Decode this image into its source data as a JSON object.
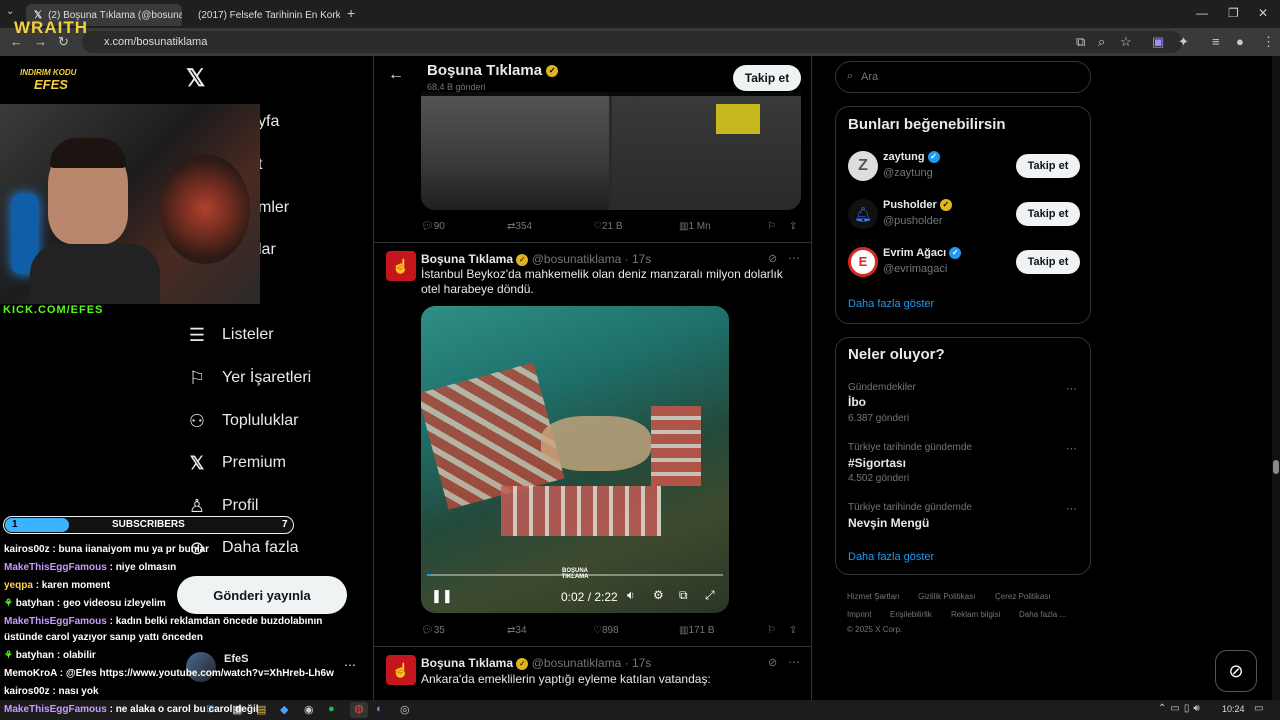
{
  "browser": {
    "tabs": [
      {
        "title": "(2) Boşuna Tıklama (@bosunati...",
        "favicon": "x-icon"
      },
      {
        "title": "(2017) Felsefe Tarihinin En Korku...",
        "favicon": "youtube-icon"
      }
    ],
    "url": "x.com/bosunatiklama"
  },
  "overlay": {
    "brand": "WRAITH",
    "discount_label": "INDIRIM KODU",
    "discount_code": "EFES",
    "kick_url": "KICK.COM/EFES",
    "subscribers_label": "SUBSCRIBERS",
    "subscribers_current": "1",
    "subscribers_goal": "7",
    "subscribers_progress": 0.14
  },
  "nav": {
    "partial_items": [
      "yfa",
      "t",
      "mler",
      "lar"
    ],
    "items": [
      {
        "label": "Listeler",
        "icon": "list-icon"
      },
      {
        "label": "Yer İşaretleri",
        "icon": "bookmark-icon"
      },
      {
        "label": "Topluluklar",
        "icon": "communities-icon"
      },
      {
        "label": "Premium",
        "icon": "x-icon"
      },
      {
        "label": "Profil",
        "icon": "profile-icon"
      },
      {
        "label": "Daha fazla",
        "icon": "more-icon"
      }
    ],
    "post_button": "Gönderi yayınla",
    "account_name": "EfeS",
    "account_handle": "@..."
  },
  "chat": [
    {
      "user": "kairos00z",
      "msg": ": buna iianaiyom mu ya pr bunlar",
      "color": "u1"
    },
    {
      "user": "MakeThisEggFamous",
      "msg": ": niye olmasın",
      "color": "u2"
    },
    {
      "user": "yeqpa",
      "msg": ": karen moment",
      "color": "u3"
    },
    {
      "user": "batyhan",
      "msg": ": geo videosu izleyelim",
      "color": "u1"
    },
    {
      "user": "MakeThisEggFamous",
      "msg": ": kadın belki reklamdan öncede buzdolabının",
      "color": "u2"
    },
    {
      "user": "",
      "msg": "üstünde carol yazıyor sanıp yattı önceden",
      "color": "u1"
    },
    {
      "user": "batyhan",
      "msg": ": olabilir",
      "color": "u1"
    },
    {
      "user": "MemoKroA",
      "msg": ": @Efes https://www.youtube.com/watch?v=XhHreb-Lh6w",
      "color": "u1"
    },
    {
      "user": "kairos00z",
      "msg": ": nası yok",
      "color": "u1"
    },
    {
      "user": "MakeThisEggFamous",
      "msg": ": ne alaka o carol bu carol değil",
      "color": "u2"
    }
  ],
  "profile_header": {
    "name": "Boşuna Tıklama",
    "posts": "68,4 B gönderi",
    "follow": "Takip et"
  },
  "tweets": [
    {
      "stats": {
        "replies": "90",
        "reposts": "354",
        "likes": "21 B",
        "views": "1 Mn"
      }
    },
    {
      "name": "Boşuna Tıklama",
      "handle": "@bosunatiklama",
      "time": "· 17s",
      "text": "İstanbul Beykoz'da mahkemelik olan deniz manzaralı milyon dolarlık otel harabeye döndü.",
      "video_time": "0:02 / 2:22",
      "video_progress": 0.015,
      "watermark": "BOŞUNA TIKLAMA",
      "stats": {
        "replies": "35",
        "reposts": "34",
        "likes": "898",
        "views": "171 B"
      }
    },
    {
      "name": "Boşuna Tıklama",
      "handle": "@bosunatiklama",
      "time": "· 17s",
      "text": "Ankara'da emeklilerin yaptığı eyleme katılan vatandaş:"
    }
  ],
  "search": {
    "placeholder": "Ara"
  },
  "suggestions": {
    "title": "Bunları beğenebilirsin",
    "items": [
      {
        "name": "zaytung",
        "handle": "@zaytung",
        "badge": "blue"
      },
      {
        "name": "Pusholder",
        "handle": "@pusholder",
        "badge": "gold"
      },
      {
        "name": "Evrim Ağacı",
        "handle": "@evrimagaci",
        "badge": "blue"
      }
    ],
    "follow": "Takip et",
    "more": "Daha fazla göster"
  },
  "trends": {
    "title": "Neler oluyor?",
    "items": [
      {
        "context": "Gündemdekiler",
        "name": "İbo",
        "count": "6.387 gönderi"
      },
      {
        "context": "Türkiye tarihinde gündemde",
        "name": "#Sigortası",
        "count": "4.502 gönderi"
      },
      {
        "context": "Türkiye tarihinde gündemde",
        "name": "Nevşin Mengü",
        "count": ""
      }
    ],
    "more": "Daha fazla göster"
  },
  "footer": {
    "links": [
      "Hizmet Şartları",
      "Gizlilik Politikası",
      "Çerez Politikası",
      "Imprint",
      "Erişilebilirlik",
      "Reklam bilgisi",
      "Daha fazla ..."
    ],
    "copyright": "© 2025 X Corp."
  },
  "taskbar": {
    "time": "10:24"
  }
}
